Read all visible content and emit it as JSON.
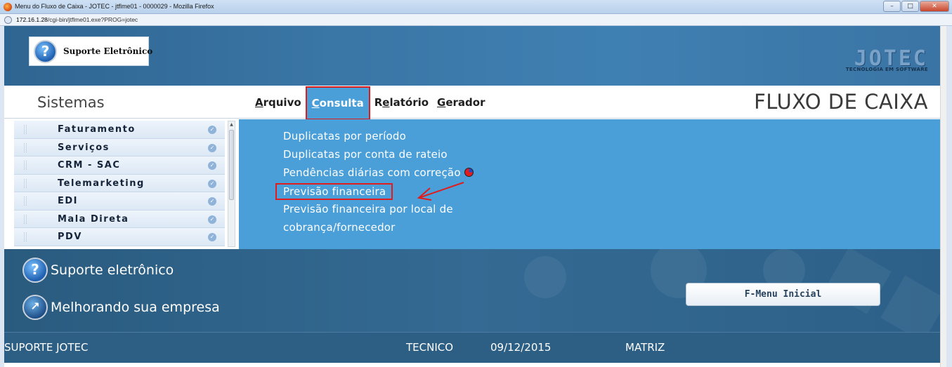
{
  "browser": {
    "window_title": "Menu do Fluxo de Caixa - JOTEC - jtflme01 - 0000029 - Mozilla Firefox",
    "url_host": "172.16.1.28",
    "url_path": "/cgi-bin/jtflme01.exe?PROG=jotec",
    "buttons": {
      "minimize": "–",
      "maximize": "□",
      "close": "✕"
    }
  },
  "header": {
    "support_button_label": "Suporte Eletrônico",
    "logo_word": "JOTEC",
    "logo_tagline": "TECNOLOGIA EM SOFTWARE"
  },
  "menubar": {
    "sidebar_title": "Sistemas",
    "menus": [
      {
        "label": "Arquivo",
        "mnemonic_index": 0
      },
      {
        "label": "Consulta",
        "mnemonic_index": 0,
        "active": true
      },
      {
        "label": "Relatório",
        "mnemonic_index": 1
      },
      {
        "label": "Gerador",
        "mnemonic_index": 0
      }
    ],
    "module_title": "FLUXO DE CAIXA"
  },
  "sidebar": {
    "items": [
      {
        "label": "Faturamento"
      },
      {
        "label": "Serviços"
      },
      {
        "label": "CRM - SAC"
      },
      {
        "label": "Telemarketing"
      },
      {
        "label": "EDI"
      },
      {
        "label": "Mala Direta"
      },
      {
        "label": "PDV"
      }
    ],
    "check_glyph": "✓"
  },
  "dropdown": {
    "items": [
      {
        "label": "Duplicatas por período"
      },
      {
        "label": "Duplicatas por conta de rateio"
      },
      {
        "label": "Pendências diárias com correção",
        "icon": "pie-chart-icon"
      },
      {
        "label": "Previsão financeira",
        "highlighted": true
      },
      {
        "label": "Previsão financeira por local de"
      },
      {
        "label": "cobrança/fornecedor"
      }
    ]
  },
  "band": {
    "support_link": "Suporte eletrônico",
    "improve_link": "Melhorando sua empresa",
    "fmenu_button": "F-Menu Inicial"
  },
  "status": {
    "company": "SUPORTE JOTEC",
    "user": "TECNICO",
    "date": "09/12/2015",
    "branch": "MATRIZ"
  },
  "colors": {
    "accent_blue": "#4a9fd9",
    "highlight_red": "#e01c1c",
    "header_blue": "#3a76a6",
    "status_blue": "#2d5f85"
  }
}
